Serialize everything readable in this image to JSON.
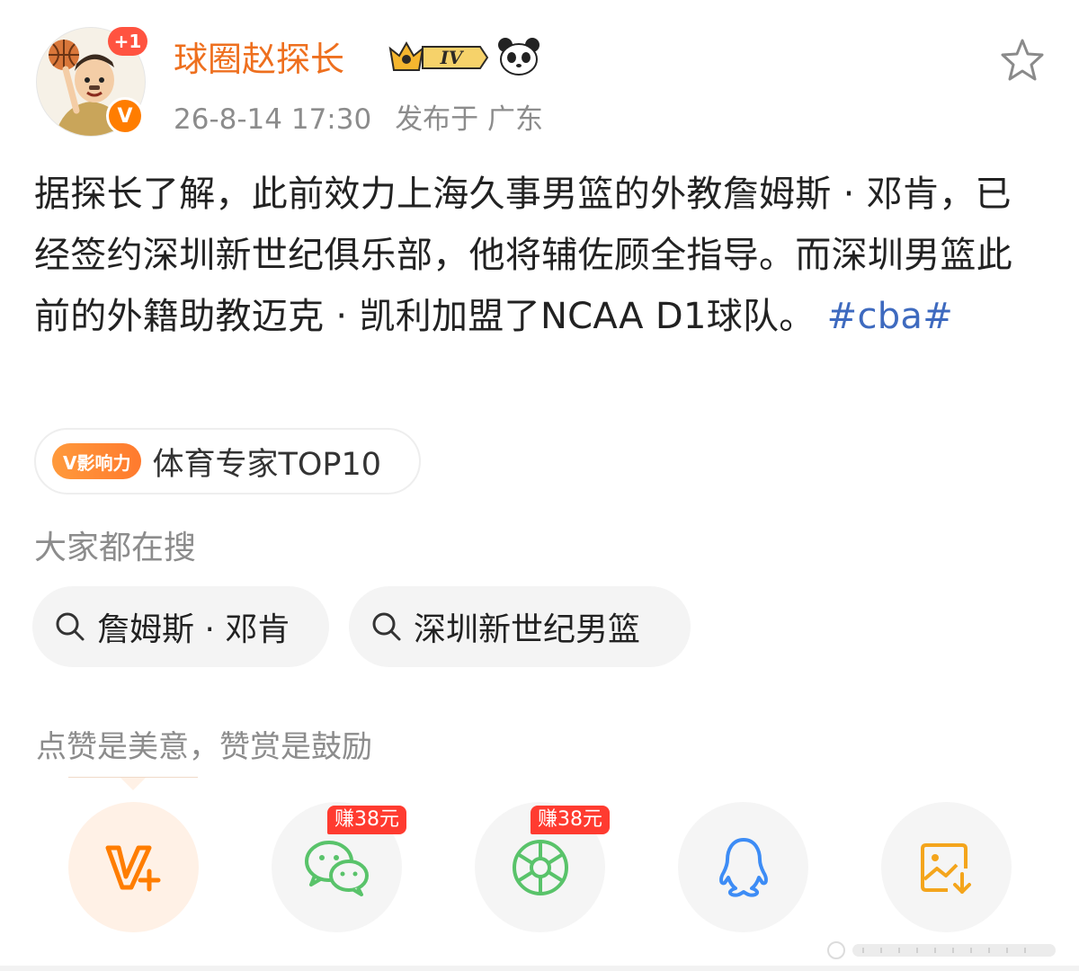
{
  "user": {
    "name": "球圈赵探长",
    "plus_badge": "+1",
    "verified_mark": "V",
    "vip_level": "IV",
    "time": "26-8-14 17:30",
    "location": "发布于 广东"
  },
  "post": {
    "text": "据探长了解，此前效力上海久事男篮的外教詹姆斯 · 邓肯，已经签约深圳新世纪俱乐部，他将辅佐顾全指导。而深圳男篮此前的外籍助教迈克 · 凯利加盟了NCAA D1球队。",
    "hashtag": "#cba#"
  },
  "influence": {
    "badge": "V影响力",
    "label": "体育专家TOP10"
  },
  "search": {
    "title": "大家都在搜",
    "chips": [
      {
        "label": "詹姆斯 · 邓肯"
      },
      {
        "label": "深圳新世纪男篮"
      }
    ]
  },
  "reward": {
    "text": "点赞是美意，赞赏是鼓励"
  },
  "share": {
    "earn_label_wechat": "赚38元",
    "earn_label_moments": "赚38元",
    "icons": [
      "v-plus-icon",
      "wechat-icon",
      "moments-icon",
      "qq-icon",
      "save-image-icon"
    ]
  },
  "colors": {
    "username": "#ee6f1e",
    "hashtag": "#3e6abf",
    "accent_orange": "#ff7d00",
    "earn_red": "#ff3b30",
    "wechat_green": "#59c36a",
    "qq_blue": "#3d8cf5"
  }
}
